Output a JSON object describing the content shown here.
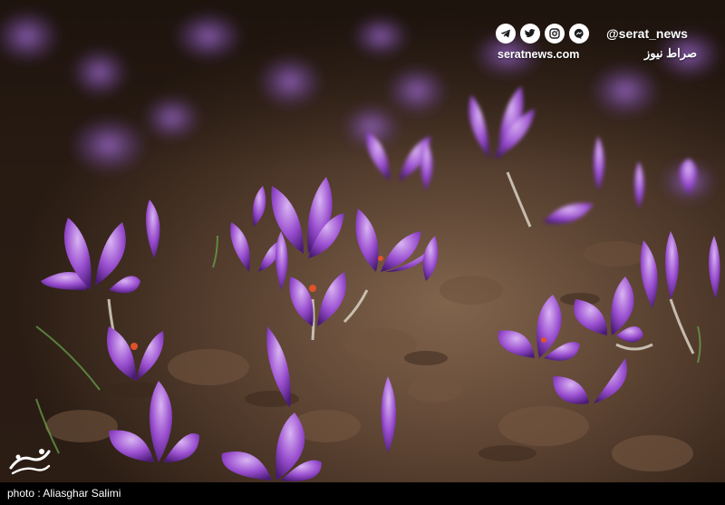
{
  "photo": {
    "subject": "purple-crocus-flowers-on-soil"
  },
  "watermark": {
    "handle": "@serat_news",
    "site": "seratnews.com",
    "brand_fa": "صراط نیوز",
    "icons": [
      "telegram-icon",
      "twitter-icon",
      "instagram-icon",
      "messenger-icon"
    ]
  },
  "caption": {
    "credit": "photo : Aliasghar Salimi"
  },
  "colors": {
    "petal": "#9a4fd0",
    "soil": "#5b4231",
    "caption_bg": "#000000"
  }
}
